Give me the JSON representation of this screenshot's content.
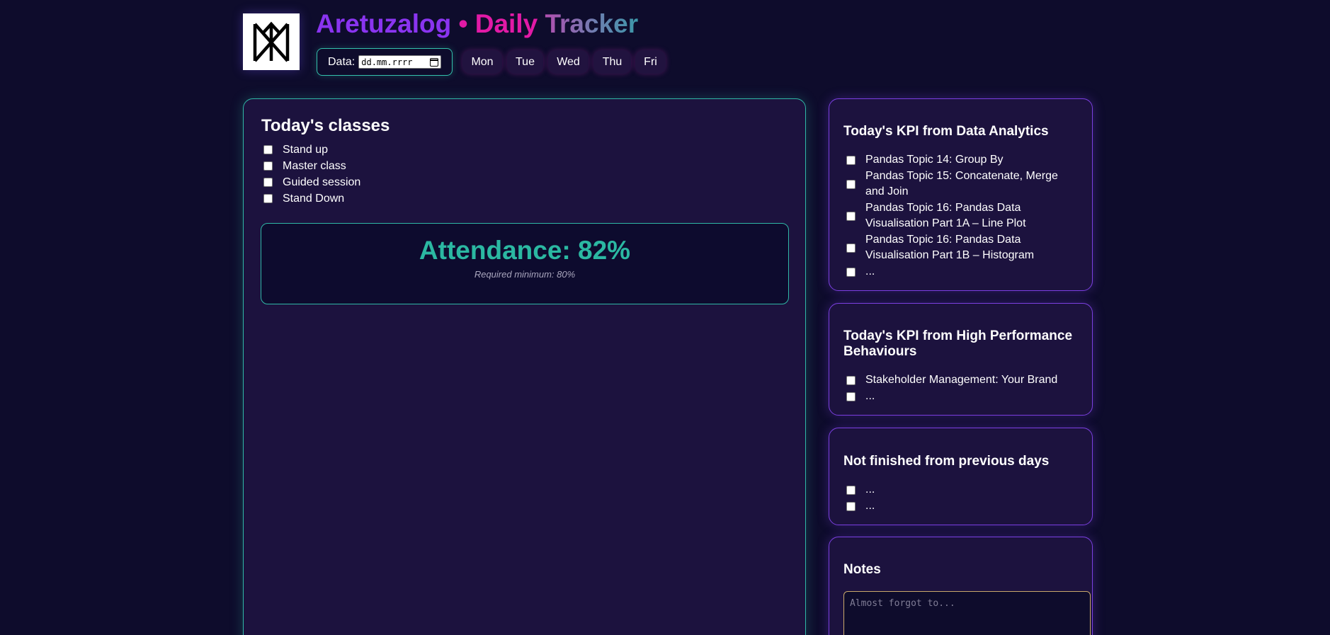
{
  "header": {
    "title_part1": "Aretuzalog",
    "title_separator": "•",
    "title_part2": "Daily",
    "title_part3": "Tracker",
    "date_label": "Data:",
    "date_placeholder": "dd.mm.rrrr",
    "days": [
      "Mon",
      "Tue",
      "Wed",
      "Thu",
      "Fri"
    ]
  },
  "classes": {
    "title": "Today's classes",
    "items": [
      "Stand up",
      "Master class",
      "Guided session",
      "Stand Down"
    ]
  },
  "attendance": {
    "value": "Attendance: 82%",
    "note": "Required minimum: 80%"
  },
  "kpi_data_analytics": {
    "title": "Today's KPI from Data Analytics",
    "items": [
      "Pandas Topic 14: Group By",
      "Pandas Topic 15: Concatenate, Merge and Join",
      "Pandas Topic 16: Pandas Data Visualisation Part 1A – Line Plot",
      "Pandas Topic 16: Pandas Data Visualisation Part 1B – Histogram",
      "..."
    ]
  },
  "kpi_high_performance": {
    "title": "Today's KPI from High Performance Behaviours",
    "items": [
      "Stakeholder Management: Your Brand",
      "..."
    ]
  },
  "unfinished": {
    "title": "Not finished from previous days",
    "items": [
      "...",
      "..."
    ]
  },
  "notes": {
    "title": "Notes",
    "placeholder": "Almost forgot to..."
  },
  "colors": {
    "background": "#0e0c2c",
    "panel": "#1c123e",
    "teal_accent": "#2fb8a6",
    "purple_accent": "#7b3fe0",
    "magenta_accent": "#e21aa6"
  }
}
